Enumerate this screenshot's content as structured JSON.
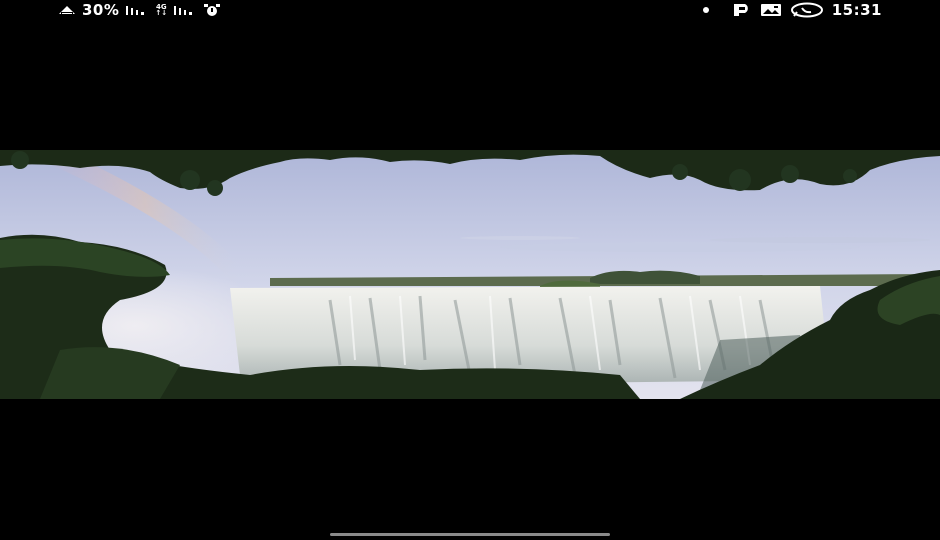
{
  "status_bar": {
    "battery_percent": "30%",
    "network_label_top": "4G",
    "network_label_bottom": "↑↓",
    "time": "15:31",
    "icons": {
      "battery": "battery-saver-icon",
      "signal1": "signal-icon",
      "signal2": "signal-icon",
      "alarm": "alarm-icon",
      "dot": "notification-dot-icon",
      "parking": "parking-p-icon",
      "gallery": "image-icon",
      "whatsapp": "whatsapp-icon"
    }
  },
  "viewer": {
    "image_subject": "waterfall-photo"
  },
  "colors": {
    "background": "#000000",
    "status_text": "#ffffff",
    "home_indicator": "#8a8a8a"
  }
}
